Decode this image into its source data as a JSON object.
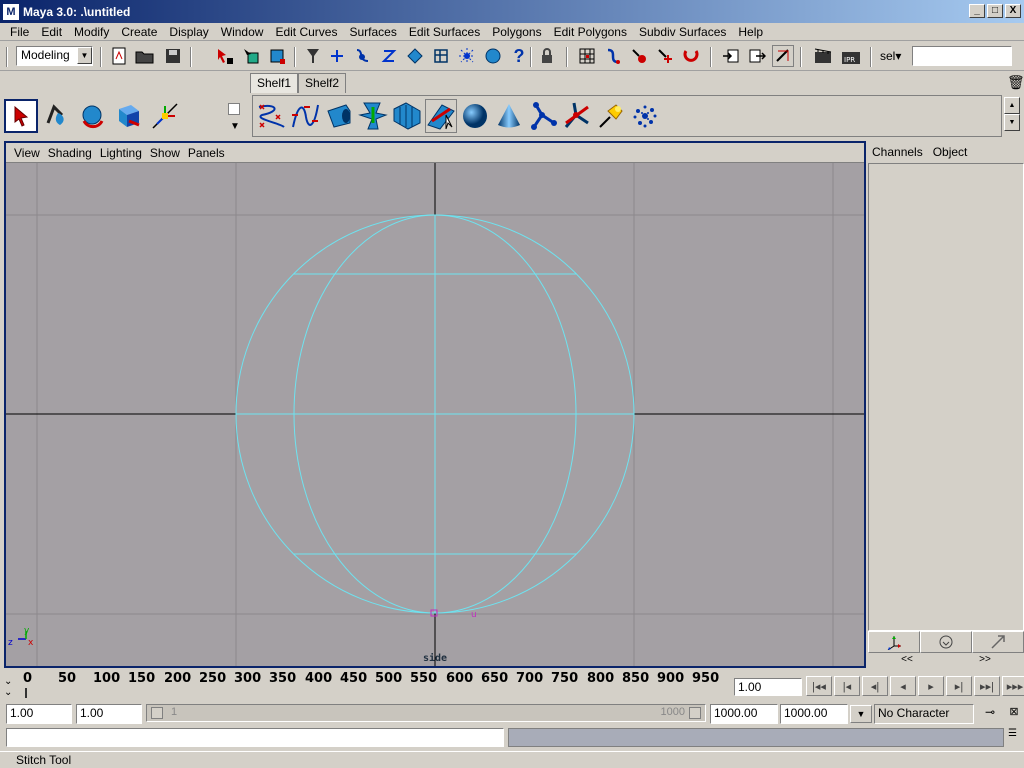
{
  "window": {
    "title": "Maya 3.0: .\\untitled",
    "min": "_",
    "max": "□",
    "close": "X"
  },
  "menubar": [
    "File",
    "Edit",
    "Modify",
    "Create",
    "Display",
    "Window",
    "Edit Curves",
    "Surfaces",
    "Edit Surfaces",
    "Polygons",
    "Edit Polygons",
    "Subdiv Surfaces",
    "Help"
  ],
  "statusline": {
    "menuset": "Modeling",
    "sel_label": "sel▾",
    "sel_value": ""
  },
  "shelf": {
    "tabs": [
      "Shelf1",
      "Shelf2"
    ],
    "active_tab": "Shelf1",
    "icons": [
      "cv-curve-icon",
      "ep-curve-icon",
      "revolve-icon",
      "loft-icon",
      "extrude-icon",
      "stitch-icon",
      "sphere-icon",
      "cone-icon",
      "joint-icon",
      "ik-handle-icon",
      "pin-icon",
      "particles-icon"
    ]
  },
  "toolbox": [
    "select-tool-icon",
    "lasso-tool-icon",
    "rotate-tool-icon",
    "scale-tool-icon",
    "manipulator-tool-icon"
  ],
  "viewport": {
    "menu": [
      "View",
      "Shading",
      "Lighting",
      "Show",
      "Panels"
    ],
    "camera_label": "side",
    "axis_y": "y",
    "axis_z": "z",
    "colors": {
      "background": "#a4a0a4",
      "grid": "#888088",
      "axis": "#000000",
      "wire": "#6ee3f0"
    }
  },
  "channelbox": {
    "tabs": [
      "Channels",
      "Object"
    ],
    "prev": "<<",
    "next": ">>"
  },
  "timeslider": {
    "ticks": [
      "0",
      "50",
      "100",
      "150",
      "200",
      "250",
      "300",
      "350",
      "400",
      "450",
      "500",
      "550",
      "600",
      "650",
      "700",
      "750",
      "800",
      "850",
      "900",
      "950"
    ],
    "current_time": "1.00",
    "playback": [
      "|◂◂",
      "|◂",
      "◂|",
      "◂",
      "▸",
      "▸|",
      "▸▸|",
      "▸▸▸"
    ]
  },
  "rangeslider": {
    "start_time": "1.00",
    "playback_start": "1.00",
    "range_start_label": "1",
    "range_end_label": "1000",
    "playback_end": "1000.00",
    "end_time": "1000.00",
    "character": "No Character"
  },
  "commandline": {
    "input": "",
    "result": ""
  },
  "helpline": "Stitch Tool"
}
